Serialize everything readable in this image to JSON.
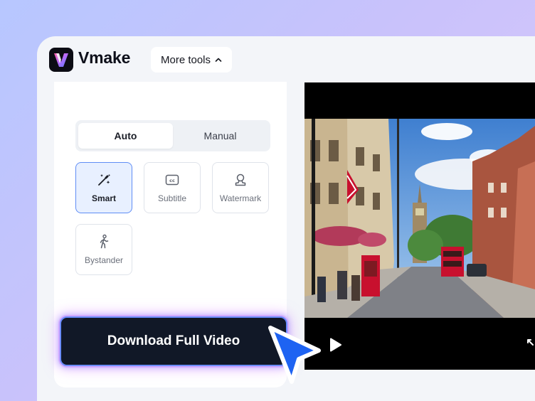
{
  "app": {
    "brand": "Vmake"
  },
  "toolbar": {
    "more_tools_label": "More tools"
  },
  "mode_tabs": [
    {
      "label": "Auto",
      "active": true
    },
    {
      "label": "Manual",
      "active": false
    }
  ],
  "tools": [
    {
      "label": "Smart",
      "icon": "magic-wand-icon",
      "selected": true
    },
    {
      "label": "Subtitle",
      "icon": "cc-icon",
      "selected": false
    },
    {
      "label": "Watermark",
      "icon": "watermark-icon",
      "selected": false
    },
    {
      "label": "Bystander",
      "icon": "walking-person-icon",
      "selected": false
    }
  ],
  "actions": {
    "download_label": "Download Full Video"
  },
  "player": {
    "play_icon": "play-icon",
    "expand_icon": "expand-icon"
  },
  "colors": {
    "accent": "#5f8df5",
    "button_bg": "#111827",
    "cursor": "#1e63f2"
  }
}
